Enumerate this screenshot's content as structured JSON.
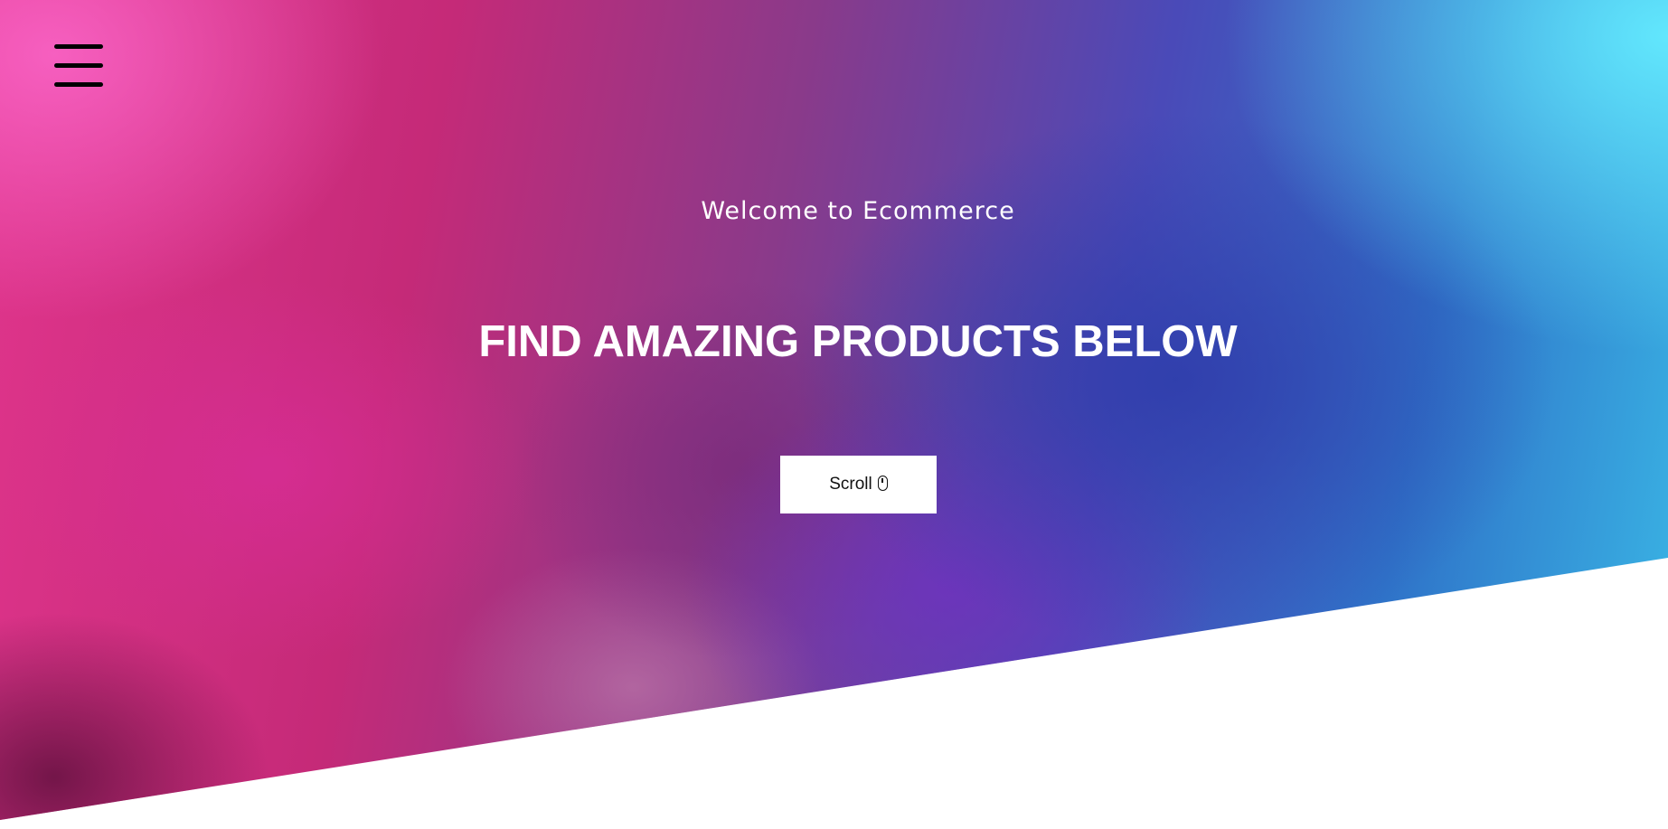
{
  "nav": {
    "menu_icon": "hamburger-menu-icon"
  },
  "hero": {
    "welcome_text": "Welcome to Ecommerce",
    "headline": "FIND AMAZING PRODUCTS BELOW",
    "scroll_button": {
      "label": "Scroll",
      "icon": "mouse-icon"
    }
  },
  "colors": {
    "gradient_pink": "#e0358c",
    "gradient_purple": "#8a3a8a",
    "gradient_blue": "#4a4ab8",
    "gradient_cyan": "#3ab8e6",
    "text": "#ffffff",
    "button_bg": "#ffffff",
    "button_text": "#111111",
    "menu_icon": "#000000"
  }
}
